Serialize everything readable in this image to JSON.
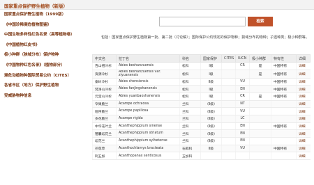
{
  "header": {
    "title": "国家重点保护野生植物（新版）"
  },
  "sidebar": {
    "items": [
      "国家重点保护野生植物（1999版）",
      "《中国珍稀濒危植物图鉴》",
      "中国生物多样性红色名录（高等植物卷）",
      "《中国植物红皮书》",
      "极小种群（狭域分布）保护物种",
      "《中国物种红色名录》（植物部分）",
      "濒危动植物种国际贸易公约（CITES）",
      "各省市区（地方）保护野生植物",
      "受威胁物种信息"
    ]
  },
  "search": {
    "placeholder": "",
    "button_label": "检索"
  },
  "description": "包括：国家重点保护野生植物第一批、第二批（讨论稿）；国际保护公约规定的保护物种；狭域分布的物种；孑遗种类；极小种群等。",
  "table": {
    "headers": [
      "中文名",
      "拉丁名",
      "科名",
      "国家保护",
      "CITES",
      "IUCN",
      "极小种群",
      "特有性",
      "详细"
    ],
    "rows": [
      [
        "百山祖冷杉",
        "Abies beshanzuensis",
        "松科",
        "Ⅰ级",
        "",
        "CR",
        "是",
        "中国特有",
        "详细"
      ],
      [
        "资源冷杉",
        "Abies beshanzuensis var. ziyuanensis",
        "松科",
        "Ⅰ级",
        "",
        "",
        "是",
        "中国特有",
        "详细"
      ],
      [
        "秦岭冷杉",
        "Abies chensiensis",
        "松科",
        "Ⅱ级",
        "",
        "VU",
        "",
        "中国特有",
        "详细"
      ],
      [
        "梵净山冷杉",
        "Abies fanjingshanensis",
        "松科",
        "Ⅰ级",
        "",
        "EN",
        "",
        "中国特有",
        "详细"
      ],
      [
        "元宝山冷杉",
        "Abies yuanbaoshanensis",
        "松科",
        "Ⅰ级",
        "",
        "CR",
        "是",
        "中国特有",
        "详细"
      ],
      [
        "窄果脆兰",
        "Acampe ochracea",
        "兰科",
        "（Ⅱ级）",
        "",
        "NT",
        "",
        "",
        "详细"
      ],
      [
        "短序脆兰",
        "Acampe papillosa",
        "兰科",
        "（Ⅱ级）",
        "",
        "VU",
        "",
        "",
        "详细"
      ],
      [
        "多花脆兰",
        "Acampe rigida",
        "兰科",
        "（Ⅱ级）",
        "",
        "LC",
        "",
        "",
        "详细"
      ],
      [
        "中华花叶兰",
        "Acanthephippium sinense",
        "兰科",
        "（Ⅱ级）",
        "",
        "EN",
        "",
        "中国特有",
        "详细"
      ],
      [
        "锥囊坛花兰",
        "Acanthephippium striatum",
        "兰科",
        "（Ⅱ级）",
        "",
        "EN",
        "",
        "",
        "详细"
      ],
      [
        "坛花兰",
        "Acanthephippium sylhetense",
        "兰科",
        "（Ⅱ级）",
        "",
        "EN",
        "",
        "",
        "详细"
      ],
      [
        "芒苞草",
        "Acanthochlamys bracteata",
        "石蒜科",
        "Ⅱ级",
        "",
        "VU",
        "",
        "中国特有",
        "详细"
      ],
      [
        "刺五加",
        "Acanthopanax senticosus",
        "五加科",
        "",
        "",
        "",
        "",
        "",
        "详细"
      ]
    ]
  }
}
